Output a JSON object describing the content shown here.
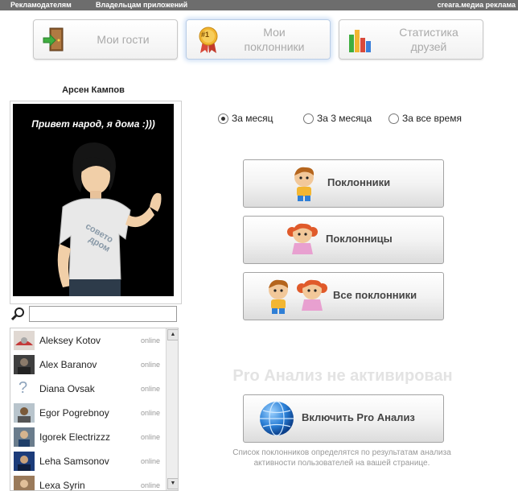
{
  "topbar": {
    "advertisers": "Рекламодателям",
    "app_owners": "Владельцам приложений",
    "brand": "creara.медиа реклама"
  },
  "tabs": [
    {
      "label": "Мои гости",
      "icon": "door-icon"
    },
    {
      "label_line1": "Мои",
      "label_line2": "поклонники",
      "icon": "award-ribbon-icon",
      "badge": "#1"
    },
    {
      "label_line1": "Статистика",
      "label_line2": "друзей",
      "icon": "bar-chart-icon"
    }
  ],
  "profile": {
    "name": "Арсен Кампов",
    "speech": "Привет народ, я дома :)))",
    "shirt_text_1": "совето",
    "shirt_text_2": "дром"
  },
  "search": {
    "placeholder": ""
  },
  "friends": [
    {
      "name": "Aleksey Kotov",
      "status": "online"
    },
    {
      "name": "Alex Baranov",
      "status": "online"
    },
    {
      "name": "Diana Ovsak",
      "status": "online"
    },
    {
      "name": "Egor Pogrebnoy",
      "status": "online"
    },
    {
      "name": "Igorek Electrizzz",
      "status": "online"
    },
    {
      "name": "Leha Samsonov",
      "status": "online"
    },
    {
      "name": "Lexa Syrin",
      "status": "online"
    }
  ],
  "periods": {
    "selected": "month",
    "month": "За месяц",
    "three_months": "За 3 месяца",
    "all_time": "За все время"
  },
  "buttons": {
    "fans_male": "Поклонники",
    "fans_female": "Поклонницы",
    "fans_all": "Все поклонники",
    "pro_enable": "Включить Pro Анализ"
  },
  "pro": {
    "inactive_title": "Pro Анализ не активирован",
    "note_line1": "Список поклонников определятся по результатам анализа",
    "note_line2": "активности пользователей на вашей странице."
  },
  "colors": {
    "topbar_bg": "#6d6d6d",
    "active_tab_glow": "#cfe0f5",
    "pro_title": "#e3e3e3"
  }
}
